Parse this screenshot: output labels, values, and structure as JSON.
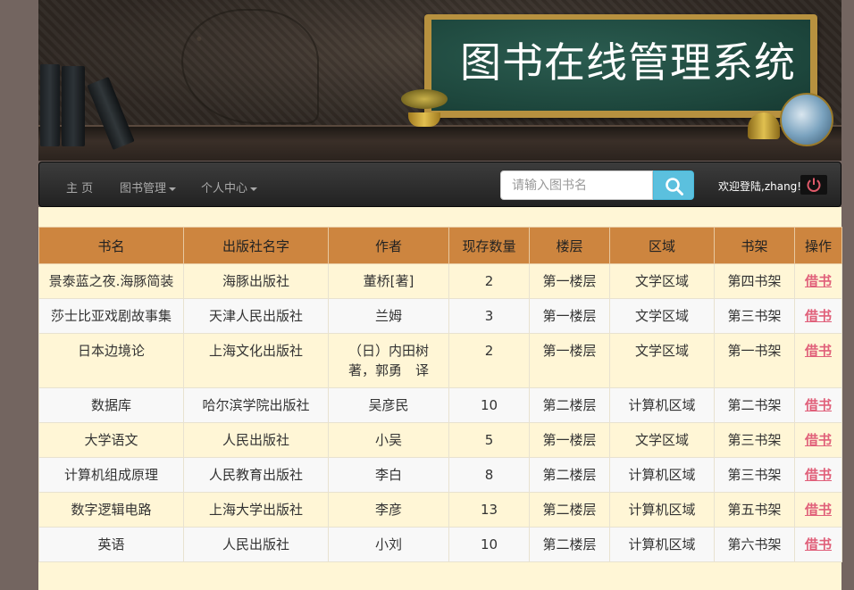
{
  "banner": {
    "title": "图书在线管理系统"
  },
  "navbar": {
    "home": "主 页",
    "book_manage": "图书管理",
    "personal_center": "个人中心",
    "search_placeholder": "请输入图书名",
    "welcome": "欢迎登陆,zhang!"
  },
  "icons": {
    "search": "search-icon",
    "power": "power-icon",
    "caret": "caret-down-icon"
  },
  "colors": {
    "header_bg": "#cd853f",
    "row_odd": "#fff6d6",
    "row_even": "#f8f8f8",
    "borrow_link": "#e0607a",
    "search_btn": "#5bc0de"
  },
  "table": {
    "headers": [
      "书名",
      "出版社名字",
      "作者",
      "现存数量",
      "楼层",
      "区域",
      "书架",
      "操作"
    ],
    "rows": [
      [
        "景泰蓝之夜.海豚简装",
        "海豚出版社",
        "董桥[著]",
        "2",
        "第一楼层",
        "文学区域",
        "第四书架",
        "借书"
      ],
      [
        "莎士比亚戏剧故事集",
        "天津人民出版社",
        "兰姆",
        "3",
        "第一楼层",
        "文学区域",
        "第三书架",
        "借书"
      ],
      [
        "日本边境论",
        "上海文化出版社",
        "（日）内田树 著，郭勇　译",
        "2",
        "第一楼层",
        "文学区域",
        "第一书架",
        "借书"
      ],
      [
        "数据库",
        "哈尔滨学院出版社",
        "吴彦民",
        "10",
        "第二楼层",
        "计算机区域",
        "第二书架",
        "借书"
      ],
      [
        "大学语文",
        "人民出版社",
        "小吴",
        "5",
        "第一楼层",
        "文学区域",
        "第三书架",
        "借书"
      ],
      [
        "计算机组成原理",
        "人民教育出版社",
        "李白",
        "8",
        "第二楼层",
        "计算机区域",
        "第三书架",
        "借书"
      ],
      [
        "数字逻辑电路",
        "上海大学出版社",
        "李彦",
        "13",
        "第二楼层",
        "计算机区域",
        "第五书架",
        "借书"
      ],
      [
        "英语",
        "人民出版社",
        "小刘",
        "10",
        "第二楼层",
        "计算机区域",
        "第六书架",
        "借书"
      ]
    ]
  }
}
